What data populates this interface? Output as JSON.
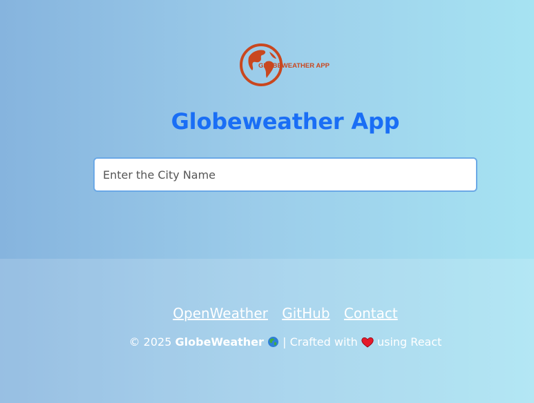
{
  "logo": {
    "text": "GLOBEWEATHER APP",
    "color": "#c9471f"
  },
  "title": "Globeweather App",
  "search": {
    "placeholder": "Enter the City Name",
    "value": ""
  },
  "footer": {
    "links": [
      {
        "label": "OpenWeather"
      },
      {
        "label": " GitHub"
      },
      {
        "label": " Contact"
      }
    ],
    "copyright_prefix": "© 2025",
    "brand": "GlobeWeather",
    "crafted_text": "| Crafted with",
    "using_text": "using React",
    "globe_icon": "globe-icon",
    "heart_icon": "heart-icon"
  },
  "colors": {
    "title": "#1a6ef5",
    "input_border": "#6aa8e6",
    "footer_text": "#ffffff"
  }
}
